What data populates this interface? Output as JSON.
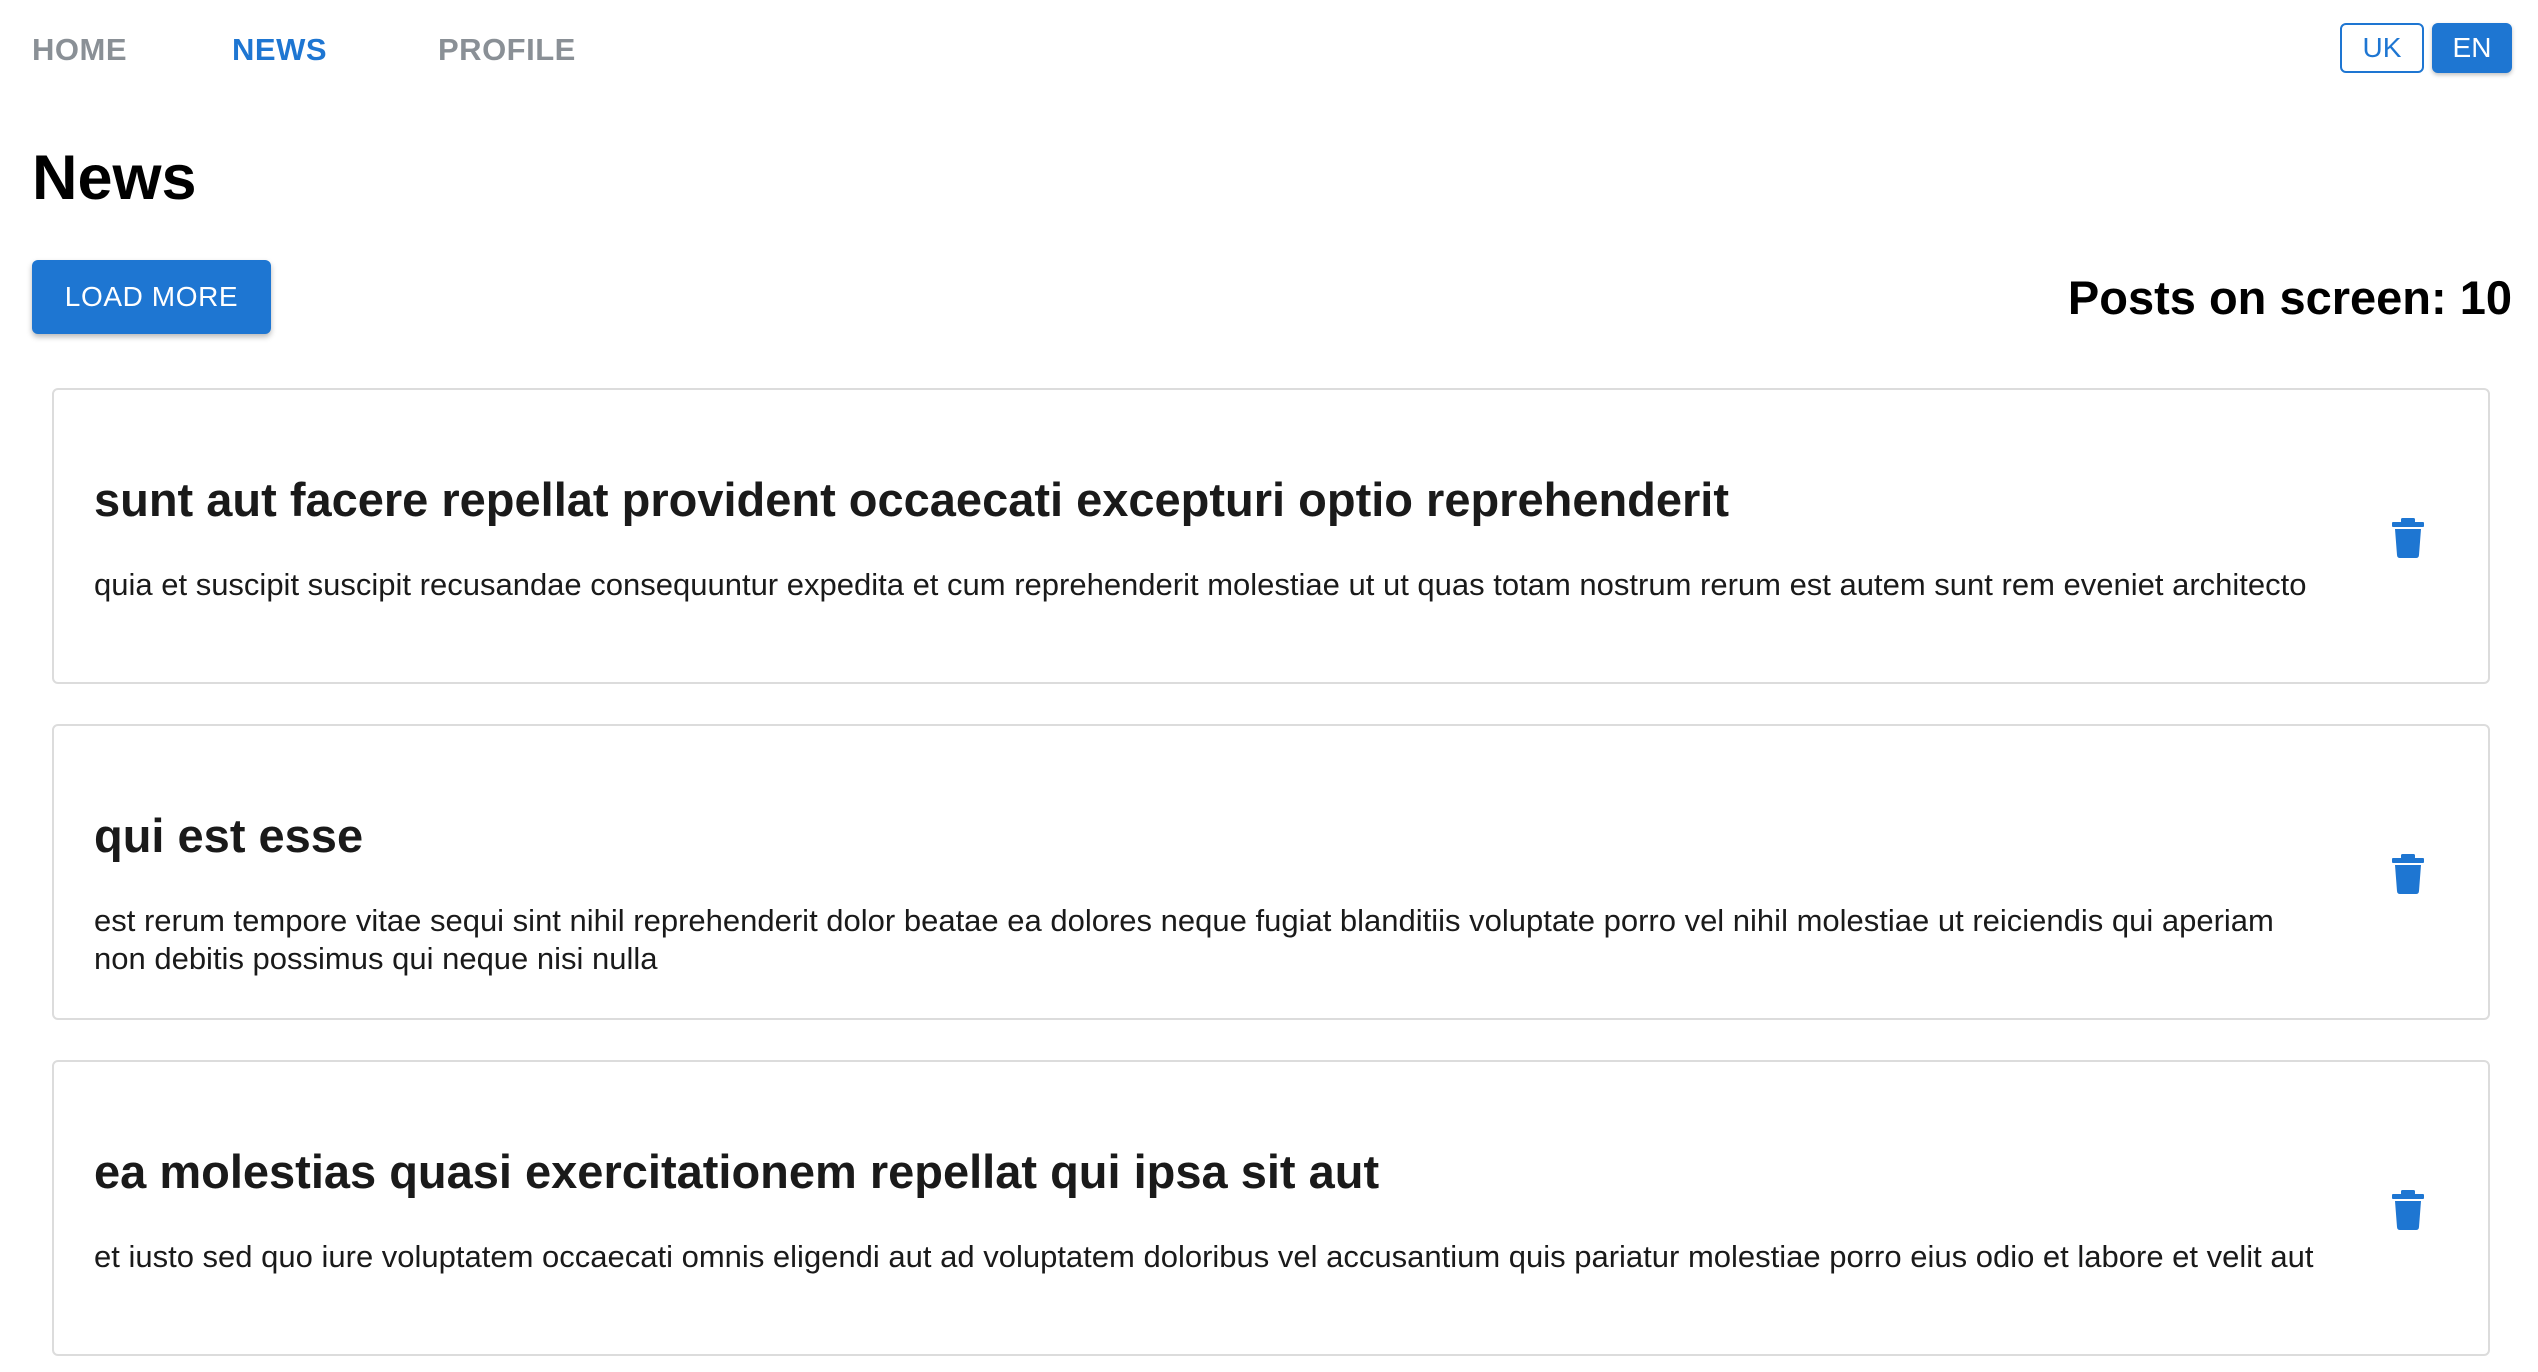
{
  "nav": {
    "items": [
      {
        "label": "HOME",
        "active": false
      },
      {
        "label": "NEWS",
        "active": true
      },
      {
        "label": "PROFILE",
        "active": false
      }
    ]
  },
  "language": {
    "options": [
      {
        "label": "UK",
        "selected": false
      },
      {
        "label": "EN",
        "selected": true
      }
    ]
  },
  "page": {
    "title": "News",
    "load_more_label": "LOAD MORE",
    "posts_on_screen_label": "Posts on screen: 10"
  },
  "posts": [
    {
      "title": "sunt aut facere repellat provident occaecati excepturi optio reprehenderit",
      "body": "quia et suscipit suscipit recusandae consequuntur expedita et cum reprehenderit molestiae ut ut quas totam nostrum rerum est autem sunt rem eveniet architecto",
      "action_icon": "trash-icon"
    },
    {
      "title": "qui est esse",
      "body": "est rerum tempore vitae sequi sint nihil reprehenderit dolor beatae ea dolores neque fugiat blanditiis voluptate porro vel nihil molestiae ut reiciendis qui aperiam non debitis possimus qui neque nisi nulla",
      "action_icon": "trash-icon"
    },
    {
      "title": "ea molestias quasi exercitationem repellat qui ipsa sit aut",
      "body": "et iusto sed quo iure voluptatem occaecati omnis eligendi aut ad voluptatem doloribus vel accusantium quis pariatur molestiae porro eius odio et labore et velit aut",
      "action_icon": "trash-icon"
    }
  ],
  "colors": {
    "accent": "#1e76d2",
    "nav_inactive": "#8a9096",
    "card_border": "#dcdcdc"
  }
}
